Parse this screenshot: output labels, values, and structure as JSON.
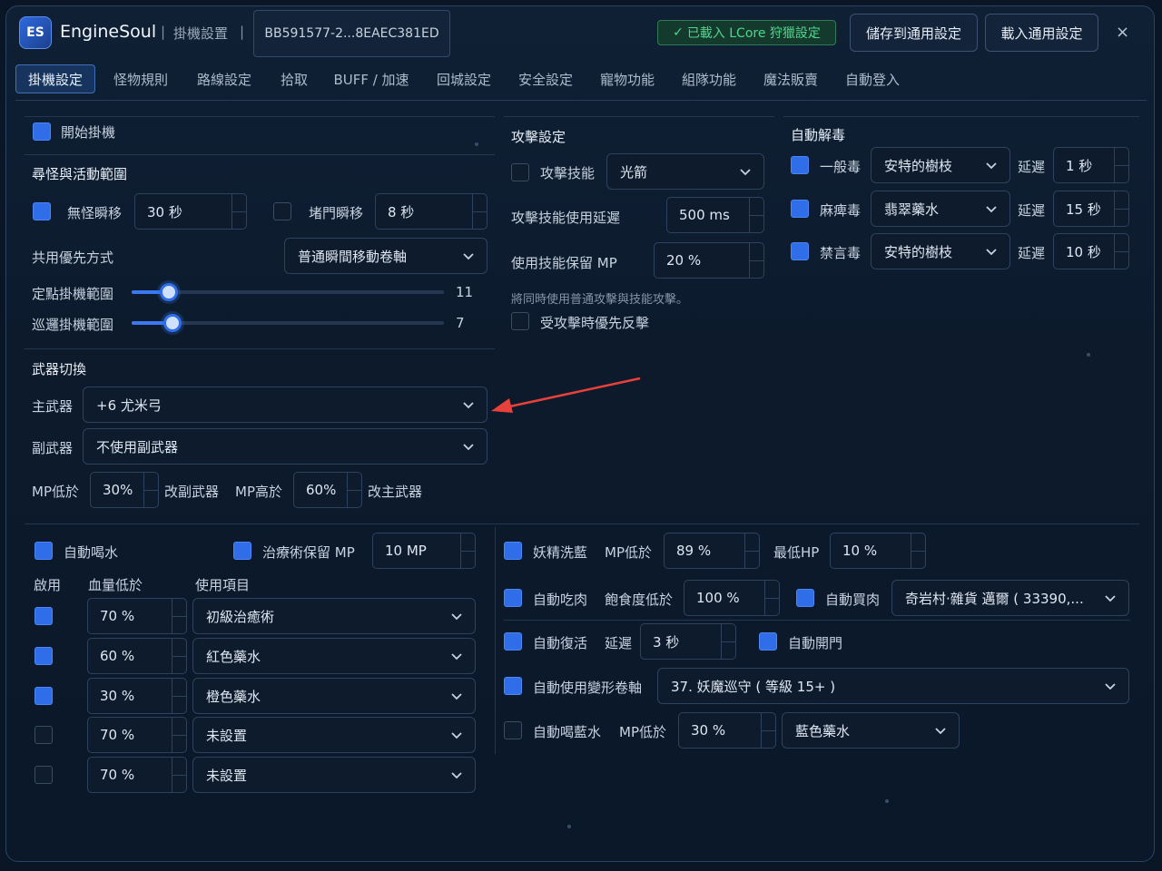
{
  "app": {
    "logo": "ES",
    "name": "EngineSoul",
    "separator": "|",
    "subtitle": "掛機設置",
    "device_id": "BB591577-2...8EAEC381ED",
    "loaded_badge": "已載入 LCore 狩獵設定",
    "check_icon": "✓",
    "save_button": "儲存到通用設定",
    "load_button": "載入通用設定",
    "close": "×"
  },
  "tabs": [
    "掛機設定",
    "怪物規則",
    "路線設定",
    "拾取",
    "BUFF / 加速",
    "回城設定",
    "安全設定",
    "寵物功能",
    "組隊功能",
    "魔法販賣",
    "自動登入"
  ],
  "main": {
    "start_label": "開始掛機",
    "start_checked": true,
    "range_title": "尋怪與活動範圍",
    "no_monster_teleport": {
      "label": "無怪瞬移",
      "checked": true,
      "value": "30 秒"
    },
    "stuck_teleport": {
      "label": "堵門瞬移",
      "checked": false,
      "value": "8 秒"
    },
    "share_priority": {
      "label": "共用優先方式",
      "value": "普通瞬間移動卷軸"
    },
    "fixed_range": {
      "label": "定點掛機範圍",
      "value": "11",
      "fraction": 0.12
    },
    "patrol_range": {
      "label": "巡邏掛機範圍",
      "value": "7",
      "fraction": 0.13
    }
  },
  "weapon": {
    "title": "武器切換",
    "main_label": "主武器",
    "main_value": "+6 尤米弓",
    "sub_label": "副武器",
    "sub_value": "不使用副武器",
    "mp_low_label": "MP低於",
    "mp_low_value": "30%",
    "switch_sub": "改副武器",
    "mp_high_label": "MP高於",
    "mp_high_value": "60%",
    "switch_main": "改主武器"
  },
  "attack": {
    "title": "攻擊設定",
    "skill": {
      "label": "攻擊技能",
      "checked": false,
      "value": "光箭"
    },
    "delay": {
      "label": "攻擊技能使用延遲",
      "value": "500 ms"
    },
    "reserve_mp": {
      "label": "使用技能保留 MP",
      "value": "20 %"
    },
    "note": "將同時使用普通攻擊與技能攻擊。",
    "counter": {
      "label": "受攻擊時優先反擊",
      "checked": false
    }
  },
  "detox": {
    "title": "自動解毒",
    "delay_label": "延遲",
    "rows": [
      {
        "name": "一般毒",
        "checked": true,
        "item": "安特的樹枝",
        "delay": "1 秒"
      },
      {
        "name": "麻痺毒",
        "checked": true,
        "item": "翡翠藥水",
        "delay": "15 秒"
      },
      {
        "name": "禁言毒",
        "checked": true,
        "item": "安特的樹枝",
        "delay": "10 秒"
      }
    ]
  },
  "potion": {
    "auto_drink": {
      "label": "自動喝水",
      "checked": true
    },
    "heal_reserve": {
      "label": "治療術保留 MP",
      "checked": true,
      "value": "10 MP"
    },
    "col_enable": "啟用",
    "col_hp": "血量低於",
    "col_item": "使用項目",
    "rows": [
      {
        "checked": true,
        "hp": "70 %",
        "item": "初級治癒術"
      },
      {
        "checked": true,
        "hp": "60 %",
        "item": "紅色藥水"
      },
      {
        "checked": true,
        "hp": "30 %",
        "item": "橙色藥水"
      },
      {
        "checked": false,
        "hp": "70 %",
        "item": "未設置"
      },
      {
        "checked": false,
        "hp": "70 %",
        "item": "未設置"
      }
    ]
  },
  "misc": {
    "fairy": {
      "label": "妖精洗藍",
      "checked": true,
      "mp_label": "MP低於",
      "mp_value": "89 %",
      "hp_label": "最低HP",
      "hp_value": "10 %"
    },
    "eat_meat": {
      "label": "自動吃肉",
      "checked": true,
      "sat_label": "飽食度低於",
      "sat_value": "100 %"
    },
    "buy_meat": {
      "label": "自動買肉",
      "checked": true,
      "value": "奇岩村·雜貨 邁爾 ( 33390,..."
    },
    "revive": {
      "label": "自動復活",
      "checked": true,
      "delay_label": "延遲",
      "delay_value": "3 秒"
    },
    "open_door": {
      "label": "自動開門",
      "checked": true
    },
    "transform": {
      "label": "自動使用變形卷軸",
      "checked": true,
      "value": "37. 妖魔巡守 ( 等級 15+ )"
    },
    "blue_potion": {
      "label": "自動喝藍水",
      "checked": false,
      "mp_label": "MP低於",
      "mp_value": "30 %",
      "item": "藍色藥水"
    }
  },
  "colors": {
    "accent": "#2f6ee8",
    "success": "#4fd68b",
    "background": "#0c1a2c",
    "annotation_arrow": "#e8403a"
  }
}
